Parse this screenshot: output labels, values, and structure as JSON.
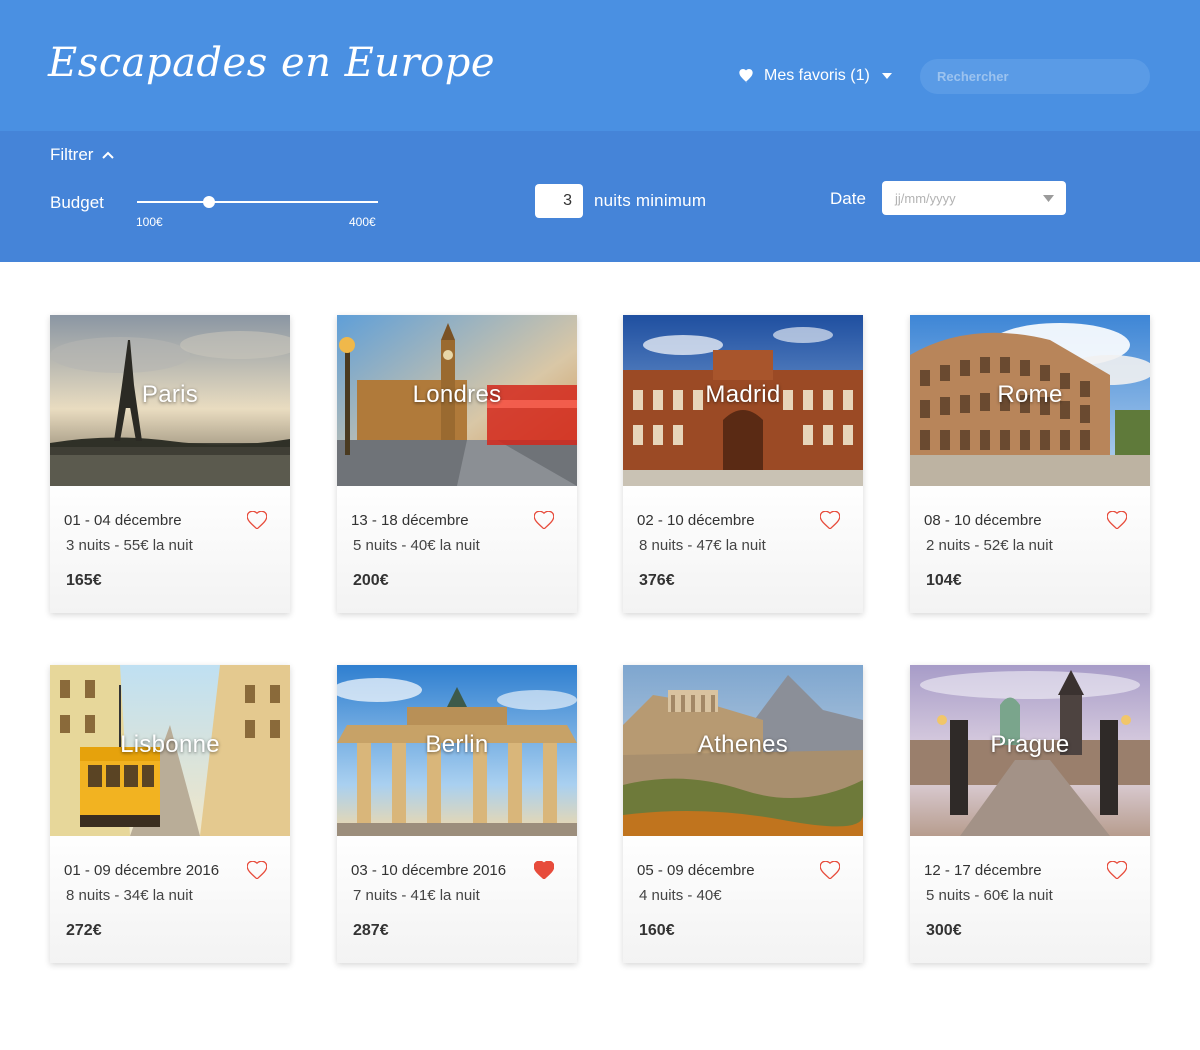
{
  "header": {
    "logo": "Escapades en Europe",
    "favorites_label": "Mes favoris (1)",
    "search_placeholder": "Rechercher"
  },
  "filters": {
    "toggle_label": "Filtrer",
    "budget_label": "Budget",
    "budget_min_label": "100€",
    "budget_max_label": "400€",
    "budget_value_fraction": 0.3,
    "nights_value": "3",
    "nights_label": "nuits minimum",
    "date_label": "Date",
    "date_placeholder": "jj/mm/yyyy"
  },
  "colors": {
    "header_bg": "#4a90e2",
    "filter_bg": "#4584d8",
    "favorite_red": "#e74c3c"
  },
  "cards": [
    {
      "city": "Paris",
      "dates": "01 - 04 décembre",
      "nights": "3 nuits - 55€ la nuit",
      "price": "165€",
      "favorite": false
    },
    {
      "city": "Londres",
      "dates": "13 - 18 décembre",
      "nights": "5 nuits - 40€ la nuit",
      "price": "200€",
      "favorite": false
    },
    {
      "city": "Madrid",
      "dates": "02 - 10 décembre",
      "nights": "8 nuits - 47€ la nuit",
      "price": "376€",
      "favorite": false
    },
    {
      "city": "Rome",
      "dates": "08 - 10 décembre",
      "nights": "2 nuits - 52€ la nuit",
      "price": "104€",
      "favorite": false
    },
    {
      "city": "Lisbonne",
      "dates": "01 - 09 décembre 2016",
      "nights": "8 nuits - 34€ la nuit",
      "price": "272€",
      "favorite": false
    },
    {
      "city": "Berlin",
      "dates": "03 - 10 décembre 2016",
      "nights": "7 nuits - 41€ la nuit",
      "price": "287€",
      "favorite": true
    },
    {
      "city": "Athenes",
      "dates": "05 - 09 décembre",
      "nights": "4 nuits - 40€",
      "price": "160€",
      "favorite": false
    },
    {
      "city": "Prague",
      "dates": "12 - 17 décembre",
      "nights": "5 nuits - 60€ la nuit",
      "price": "300€",
      "favorite": false
    }
  ]
}
